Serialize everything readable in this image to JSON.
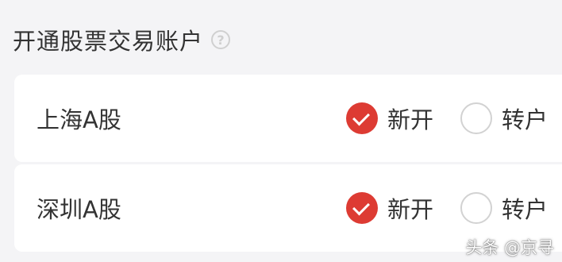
{
  "section": {
    "title": "开通股票交易账户",
    "help_icon": "question-circle-icon"
  },
  "accounts": [
    {
      "market": "上海A股",
      "new_label": "新开",
      "transfer_label": "转户",
      "selected": "新开"
    },
    {
      "market": "深圳A股",
      "new_label": "新开",
      "transfer_label": "转户",
      "selected": "新开"
    }
  ],
  "colors": {
    "accent": "#dd3b33",
    "text": "#333333",
    "background": "#f4f4f6",
    "card": "#ffffff"
  },
  "watermark": "头条 @京寻"
}
